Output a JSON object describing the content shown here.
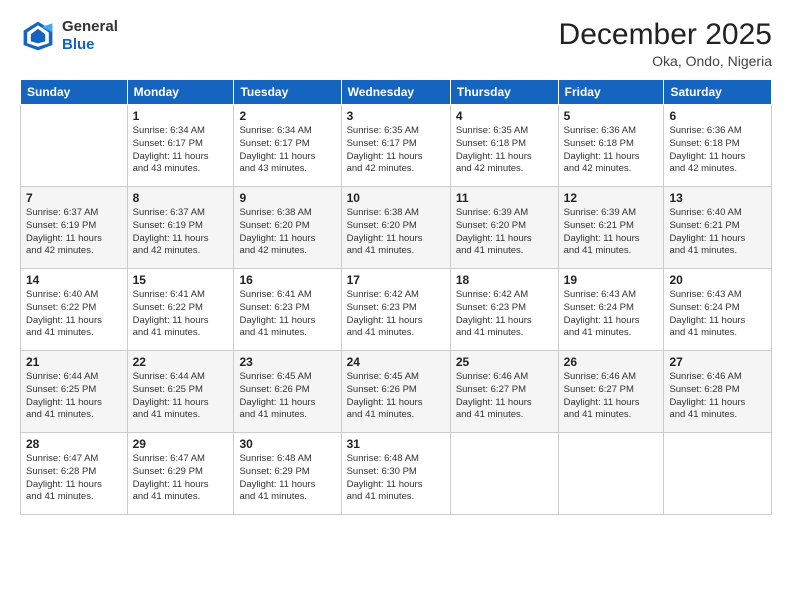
{
  "header": {
    "logo": {
      "general": "General",
      "blue": "Blue"
    },
    "title": "December 2025",
    "location": "Oka, Ondo, Nigeria"
  },
  "days_of_week": [
    "Sunday",
    "Monday",
    "Tuesday",
    "Wednesday",
    "Thursday",
    "Friday",
    "Saturday"
  ],
  "weeks": [
    [
      {
        "day": "",
        "info": ""
      },
      {
        "day": "1",
        "info": "Sunrise: 6:34 AM\nSunset: 6:17 PM\nDaylight: 11 hours\nand 43 minutes."
      },
      {
        "day": "2",
        "info": "Sunrise: 6:34 AM\nSunset: 6:17 PM\nDaylight: 11 hours\nand 43 minutes."
      },
      {
        "day": "3",
        "info": "Sunrise: 6:35 AM\nSunset: 6:17 PM\nDaylight: 11 hours\nand 42 minutes."
      },
      {
        "day": "4",
        "info": "Sunrise: 6:35 AM\nSunset: 6:18 PM\nDaylight: 11 hours\nand 42 minutes."
      },
      {
        "day": "5",
        "info": "Sunrise: 6:36 AM\nSunset: 6:18 PM\nDaylight: 11 hours\nand 42 minutes."
      },
      {
        "day": "6",
        "info": "Sunrise: 6:36 AM\nSunset: 6:18 PM\nDaylight: 11 hours\nand 42 minutes."
      }
    ],
    [
      {
        "day": "7",
        "info": "Sunrise: 6:37 AM\nSunset: 6:19 PM\nDaylight: 11 hours\nand 42 minutes."
      },
      {
        "day": "8",
        "info": "Sunrise: 6:37 AM\nSunset: 6:19 PM\nDaylight: 11 hours\nand 42 minutes."
      },
      {
        "day": "9",
        "info": "Sunrise: 6:38 AM\nSunset: 6:20 PM\nDaylight: 11 hours\nand 42 minutes."
      },
      {
        "day": "10",
        "info": "Sunrise: 6:38 AM\nSunset: 6:20 PM\nDaylight: 11 hours\nand 41 minutes."
      },
      {
        "day": "11",
        "info": "Sunrise: 6:39 AM\nSunset: 6:20 PM\nDaylight: 11 hours\nand 41 minutes."
      },
      {
        "day": "12",
        "info": "Sunrise: 6:39 AM\nSunset: 6:21 PM\nDaylight: 11 hours\nand 41 minutes."
      },
      {
        "day": "13",
        "info": "Sunrise: 6:40 AM\nSunset: 6:21 PM\nDaylight: 11 hours\nand 41 minutes."
      }
    ],
    [
      {
        "day": "14",
        "info": "Sunrise: 6:40 AM\nSunset: 6:22 PM\nDaylight: 11 hours\nand 41 minutes."
      },
      {
        "day": "15",
        "info": "Sunrise: 6:41 AM\nSunset: 6:22 PM\nDaylight: 11 hours\nand 41 minutes."
      },
      {
        "day": "16",
        "info": "Sunrise: 6:41 AM\nSunset: 6:23 PM\nDaylight: 11 hours\nand 41 minutes."
      },
      {
        "day": "17",
        "info": "Sunrise: 6:42 AM\nSunset: 6:23 PM\nDaylight: 11 hours\nand 41 minutes."
      },
      {
        "day": "18",
        "info": "Sunrise: 6:42 AM\nSunset: 6:23 PM\nDaylight: 11 hours\nand 41 minutes."
      },
      {
        "day": "19",
        "info": "Sunrise: 6:43 AM\nSunset: 6:24 PM\nDaylight: 11 hours\nand 41 minutes."
      },
      {
        "day": "20",
        "info": "Sunrise: 6:43 AM\nSunset: 6:24 PM\nDaylight: 11 hours\nand 41 minutes."
      }
    ],
    [
      {
        "day": "21",
        "info": "Sunrise: 6:44 AM\nSunset: 6:25 PM\nDaylight: 11 hours\nand 41 minutes."
      },
      {
        "day": "22",
        "info": "Sunrise: 6:44 AM\nSunset: 6:25 PM\nDaylight: 11 hours\nand 41 minutes."
      },
      {
        "day": "23",
        "info": "Sunrise: 6:45 AM\nSunset: 6:26 PM\nDaylight: 11 hours\nand 41 minutes."
      },
      {
        "day": "24",
        "info": "Sunrise: 6:45 AM\nSunset: 6:26 PM\nDaylight: 11 hours\nand 41 minutes."
      },
      {
        "day": "25",
        "info": "Sunrise: 6:46 AM\nSunset: 6:27 PM\nDaylight: 11 hours\nand 41 minutes."
      },
      {
        "day": "26",
        "info": "Sunrise: 6:46 AM\nSunset: 6:27 PM\nDaylight: 11 hours\nand 41 minutes."
      },
      {
        "day": "27",
        "info": "Sunrise: 6:46 AM\nSunset: 6:28 PM\nDaylight: 11 hours\nand 41 minutes."
      }
    ],
    [
      {
        "day": "28",
        "info": "Sunrise: 6:47 AM\nSunset: 6:28 PM\nDaylight: 11 hours\nand 41 minutes."
      },
      {
        "day": "29",
        "info": "Sunrise: 6:47 AM\nSunset: 6:29 PM\nDaylight: 11 hours\nand 41 minutes."
      },
      {
        "day": "30",
        "info": "Sunrise: 6:48 AM\nSunset: 6:29 PM\nDaylight: 11 hours\nand 41 minutes."
      },
      {
        "day": "31",
        "info": "Sunrise: 6:48 AM\nSunset: 6:30 PM\nDaylight: 11 hours\nand 41 minutes."
      },
      {
        "day": "",
        "info": ""
      },
      {
        "day": "",
        "info": ""
      },
      {
        "day": "",
        "info": ""
      }
    ]
  ]
}
